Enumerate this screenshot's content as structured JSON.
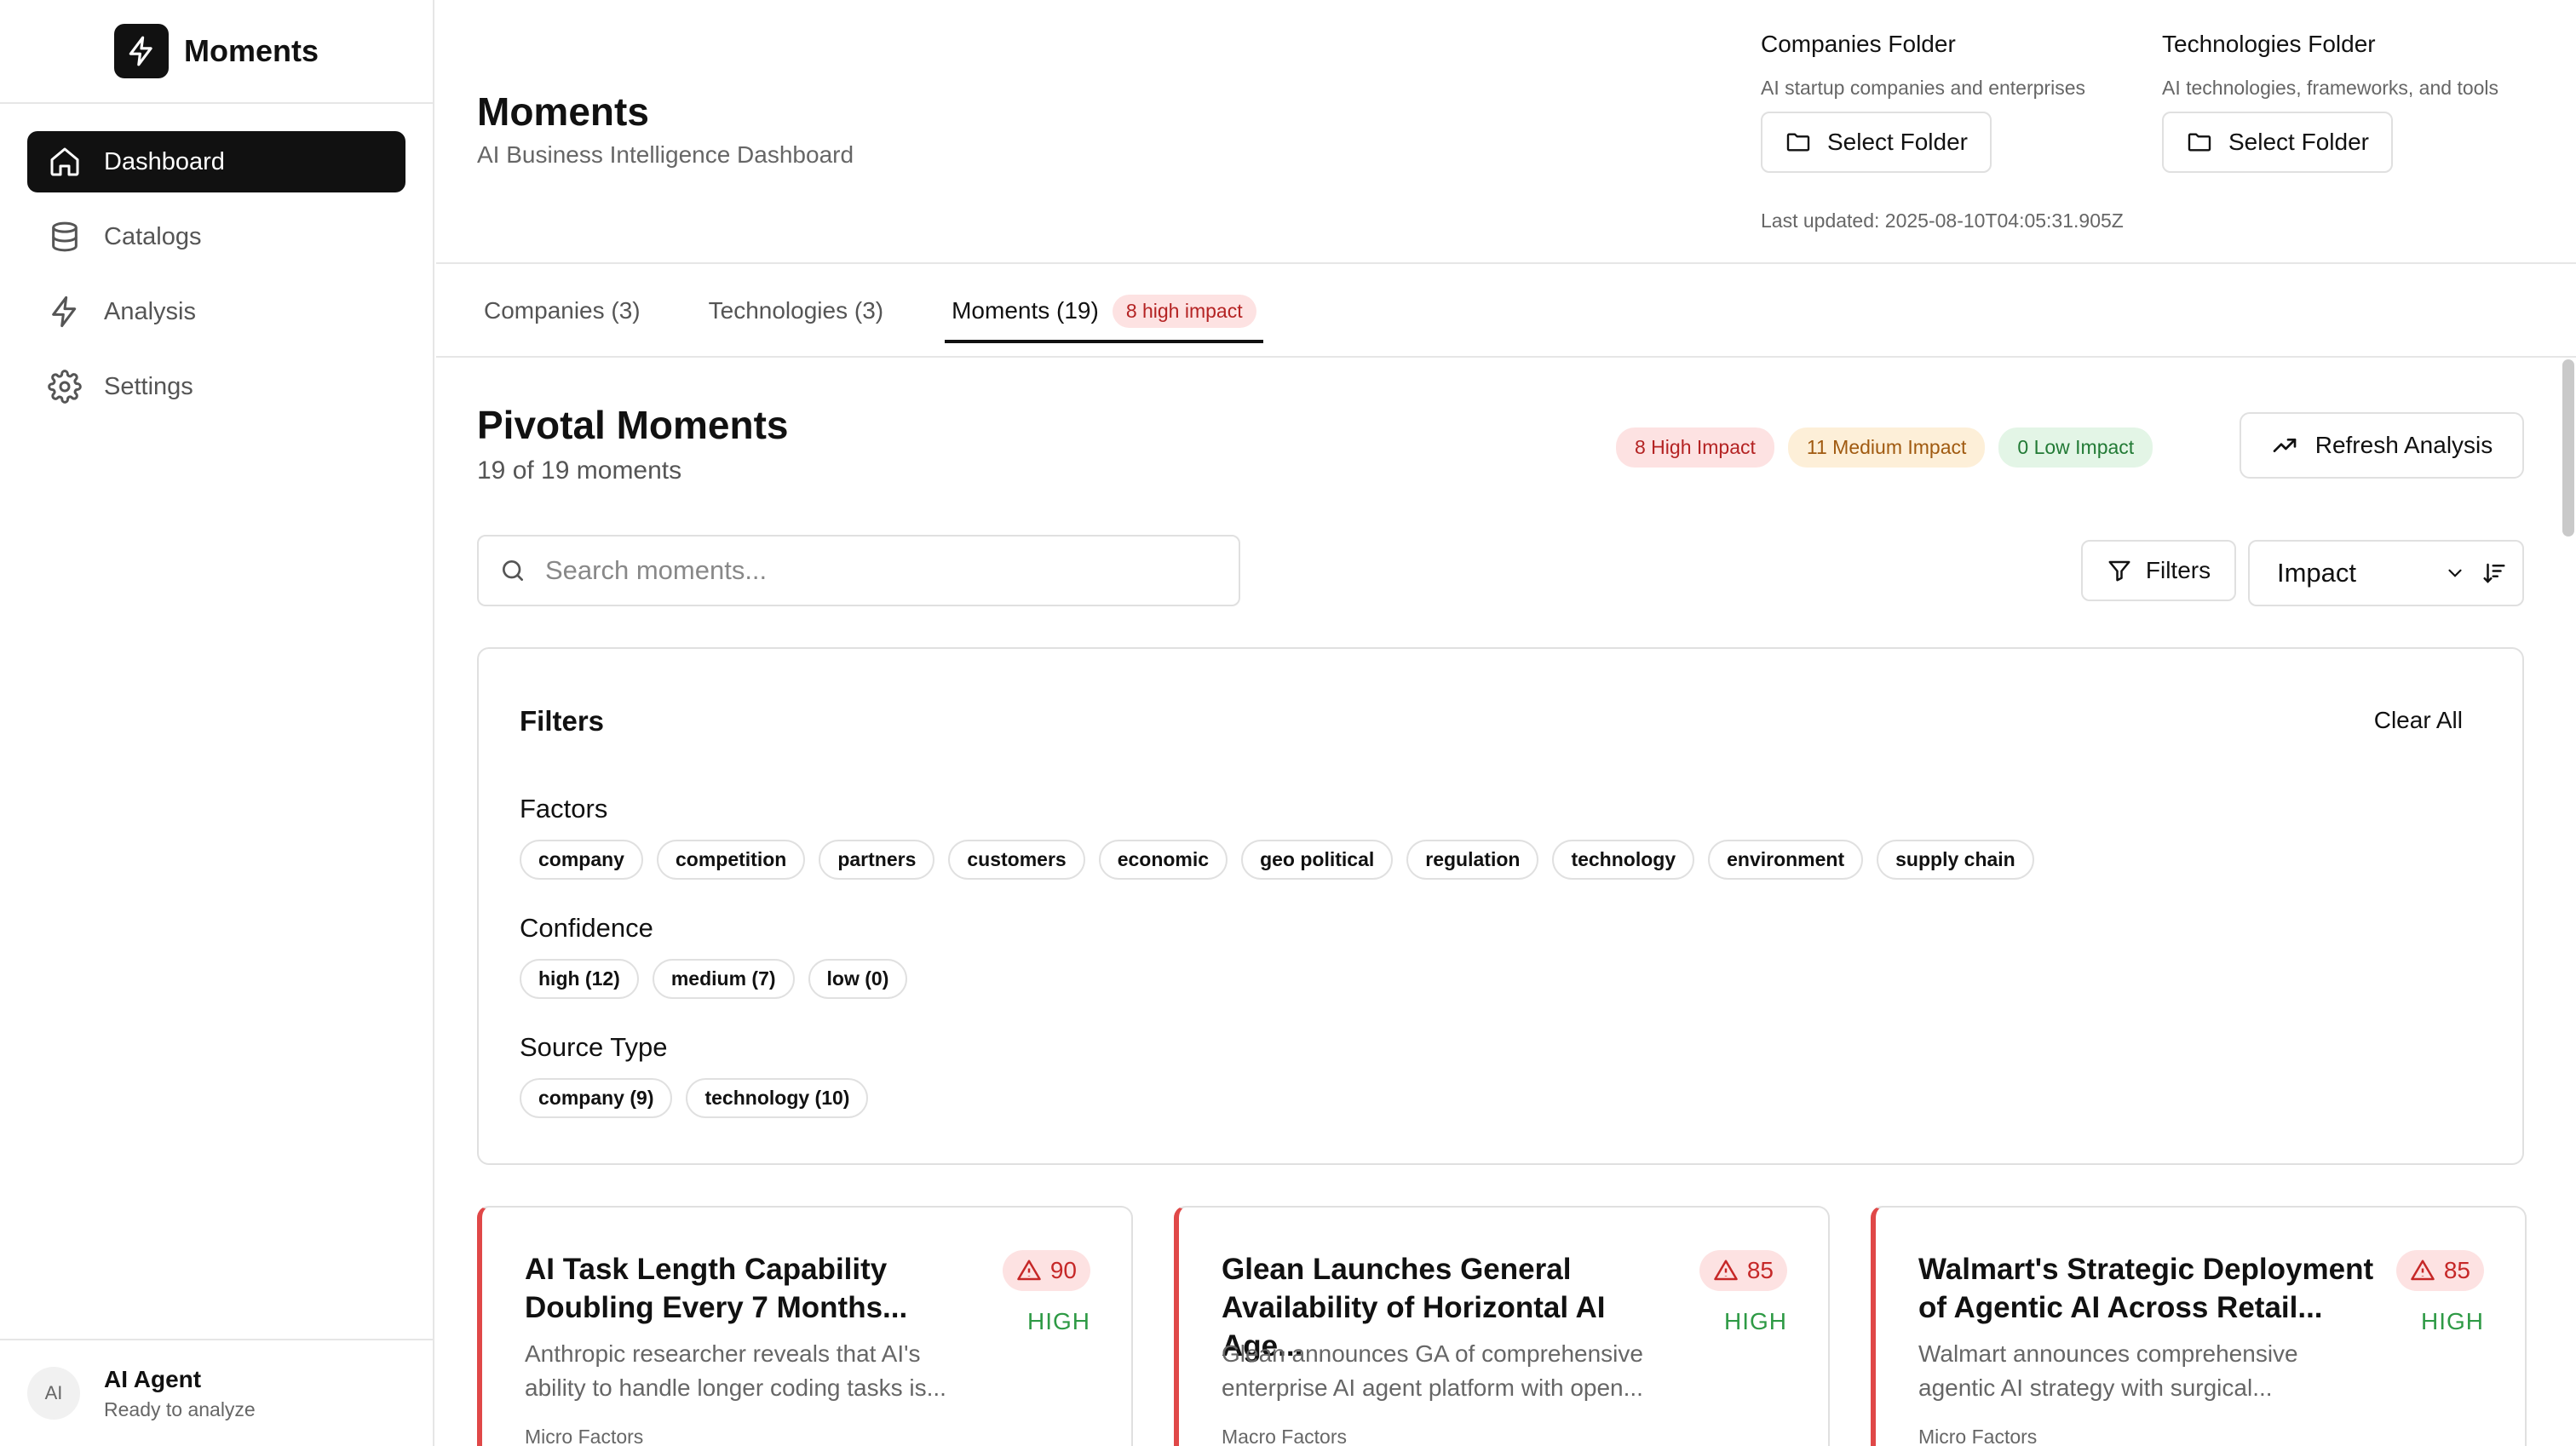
{
  "app": {
    "name": "Moments"
  },
  "sidebar": {
    "items": [
      {
        "label": "Dashboard",
        "icon": "home-icon",
        "active": true
      },
      {
        "label": "Catalogs",
        "icon": "database-icon",
        "active": false
      },
      {
        "label": "Analysis",
        "icon": "zap-icon",
        "active": false
      },
      {
        "label": "Settings",
        "icon": "gear-icon",
        "active": false
      }
    ],
    "agent": {
      "avatar": "AI",
      "name": "AI Agent",
      "status": "Ready to analyze"
    }
  },
  "header": {
    "title": "Moments",
    "subtitle": "AI Business Intelligence Dashboard",
    "companies_folder": {
      "title": "Companies Folder",
      "description": "AI startup companies and enterprises",
      "button": "Select Folder"
    },
    "technologies_folder": {
      "title": "Technologies Folder",
      "description": "AI technologies, frameworks, and tools",
      "button": "Select Folder"
    },
    "last_updated": "Last updated: 2025-08-10T04:05:31.905Z"
  },
  "tabs": [
    {
      "label": "Companies (3)"
    },
    {
      "label": "Technologies (3)"
    },
    {
      "label": "Moments (19)",
      "badge": "8 high impact",
      "active": true
    }
  ],
  "main": {
    "title": "Pivotal Moments",
    "subtitle": "19 of 19 moments",
    "impact_badges": {
      "high": "8 High Impact",
      "medium": "11 Medium Impact",
      "low": "0 Low Impact"
    },
    "refresh_label": "Refresh Analysis",
    "search_placeholder": "Search moments...",
    "filters_button": "Filters",
    "sort_value": "Impact"
  },
  "filters": {
    "title": "Filters",
    "clear_label": "Clear All",
    "factors_label": "Factors",
    "factors": [
      "company",
      "competition",
      "partners",
      "customers",
      "economic",
      "geo political",
      "regulation",
      "technology",
      "environment",
      "supply chain"
    ],
    "confidence_label": "Confidence",
    "confidence": [
      "high (12)",
      "medium (7)",
      "low (0)"
    ],
    "source_label": "Source Type",
    "source": [
      "company (9)",
      "technology (10)"
    ]
  },
  "cards": [
    {
      "title": "AI Task Length Capability Doubling Every 7 Months...",
      "score": "90",
      "level": "HIGH",
      "description": "Anthropic researcher reveals that AI's ability to handle longer coding tasks is...",
      "factor": "Micro Factors"
    },
    {
      "title": "Glean Launches General Availability of Horizontal AI Age...",
      "score": "85",
      "level": "HIGH",
      "description": "Glean announces GA of comprehensive enterprise AI agent platform with open...",
      "factor": "Macro Factors"
    },
    {
      "title": "Walmart's Strategic Deployment of Agentic AI Across Retail...",
      "score": "85",
      "level": "HIGH",
      "description": "Walmart announces comprehensive agentic AI strategy with surgical...",
      "factor": "Micro Factors"
    }
  ],
  "colors": {
    "accent": "#111111",
    "high": "#c62828",
    "medium": "#a05a10",
    "low": "#227a35",
    "card_border": "#e04848"
  }
}
